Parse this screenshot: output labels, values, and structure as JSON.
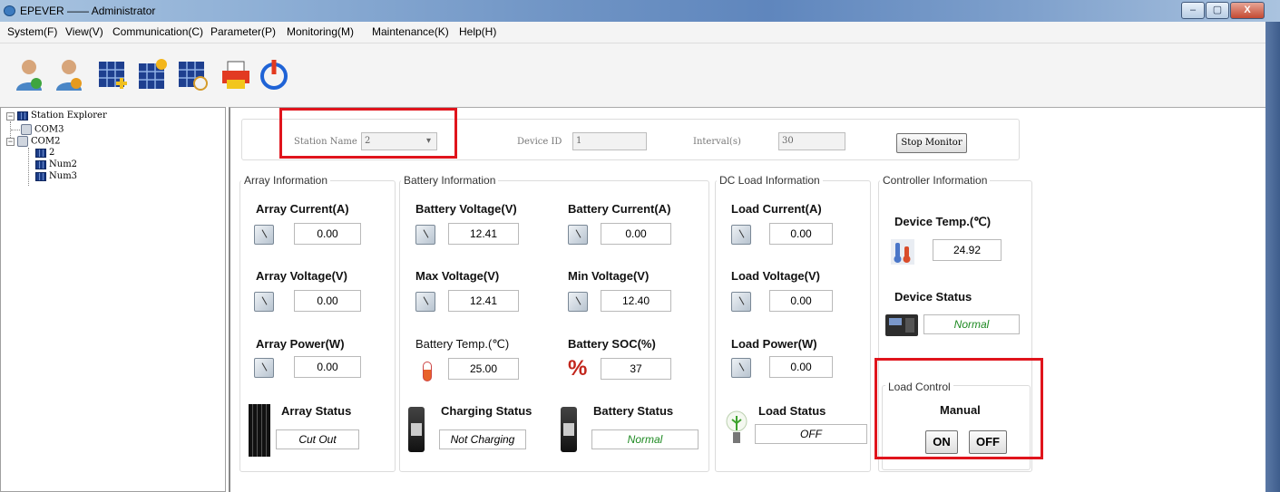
{
  "window": {
    "title": "EPEVER —— Administrator",
    "minimize": "–",
    "maximize": "▢",
    "close": "X"
  },
  "menu": [
    "System(F)",
    "View(V)",
    "Communication(C)",
    "Parameter(P)",
    "Monitoring(M)",
    "Maintenance(K)",
    "Help(H)"
  ],
  "toolbar": {
    "icons": [
      "user-icon",
      "user-settings-icon",
      "solar-add-icon",
      "solar-sun-icon",
      "solar-clock-icon",
      "printer-icon",
      "power-icon"
    ]
  },
  "tree": {
    "root": "Station Explorer",
    "com3": "COM3",
    "com2": "COM2",
    "item2": "2",
    "num2": "Num2",
    "num3": "Num3"
  },
  "header": {
    "station_name_label": "Station Name",
    "station_name_value": "2",
    "device_id_label": "Device ID",
    "device_id_value": "1",
    "interval_label": "Interval(s)",
    "interval_value": "30",
    "stop_button": "Stop Monitor"
  },
  "array": {
    "title": "Array Information",
    "current_label": "Array Current(A)",
    "current": "0.00",
    "voltage_label": "Array Voltage(V)",
    "voltage": "0.00",
    "power_label": "Array Power(W)",
    "power": "0.00",
    "status_label": "Array Status",
    "status": "Cut Out"
  },
  "battery": {
    "title": "Battery Information",
    "voltage_label": "Battery Voltage(V)",
    "voltage": "12.41",
    "current_label": "Battery Current(A)",
    "current": "0.00",
    "max_label": "Max Voltage(V)",
    "max": "12.41",
    "min_label": "Min Voltage(V)",
    "min": "12.40",
    "temp_label": "Battery Temp.(℃)",
    "temp": "25.00",
    "soc_label": "Battery SOC(%)",
    "soc": "37",
    "charging_label": "Charging Status",
    "charging": "Not Charging",
    "status_label": "Battery Status",
    "status": "Normal"
  },
  "load": {
    "title": "DC Load Information",
    "current_label": "Load Current(A)",
    "current": "0.00",
    "voltage_label": "Load Voltage(V)",
    "voltage": "0.00",
    "power_label": "Load Power(W)",
    "power": "0.00",
    "status_label": "Load Status",
    "status": "OFF"
  },
  "controller": {
    "title": "Controller Information",
    "temp_label": "Device Temp.(℃)",
    "temp": "24.92",
    "status_label": "Device Status",
    "status": "Normal"
  },
  "load_control": {
    "title": "Load Control",
    "mode": "Manual",
    "on": "ON",
    "off": "OFF"
  },
  "colors": {
    "highlight": "#e0141c",
    "normal_text": "#1e8a22"
  }
}
